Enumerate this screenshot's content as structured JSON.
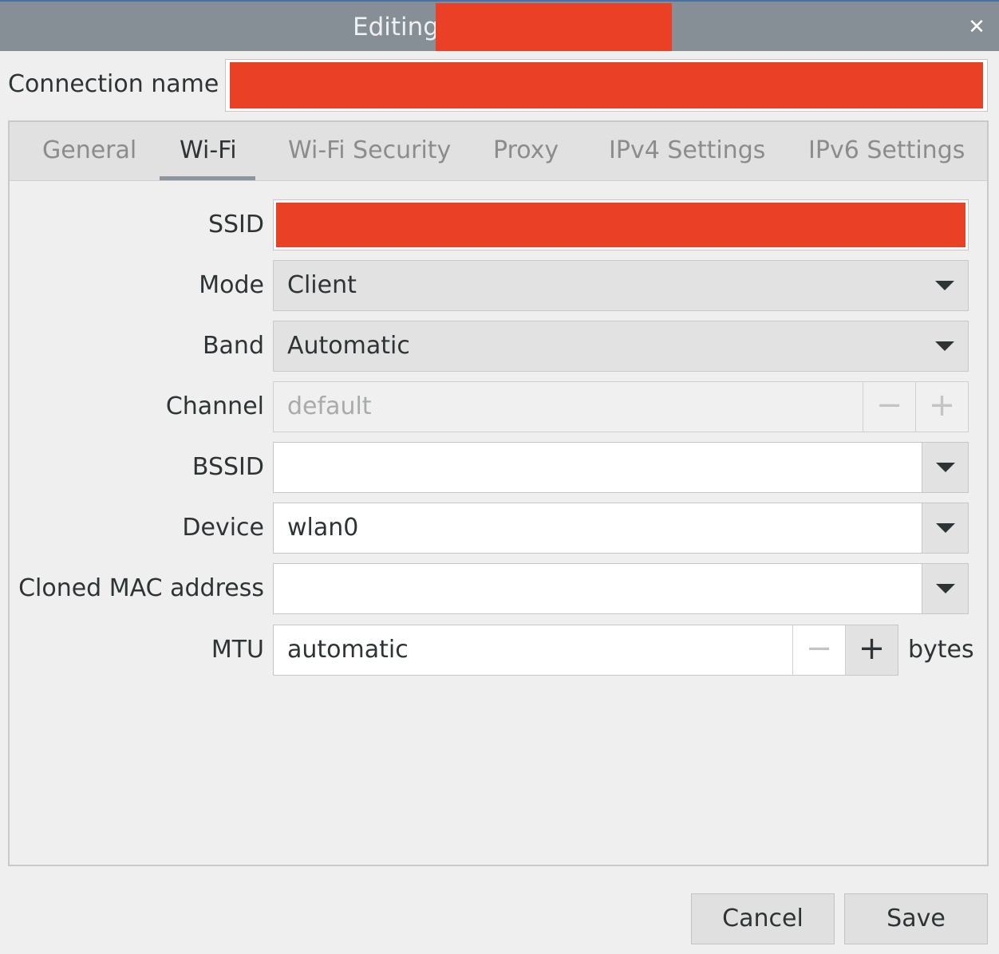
{
  "window": {
    "title": "Editing",
    "close_icon": "close-icon",
    "title_color": "#868e96",
    "redaction_color": "#ea4025"
  },
  "connection": {
    "label": "Connection name",
    "value": ""
  },
  "tabs": [
    {
      "label": "General",
      "active": false
    },
    {
      "label": "Wi-Fi",
      "active": true
    },
    {
      "label": "Wi-Fi Security",
      "active": false
    },
    {
      "label": "Proxy",
      "active": false
    },
    {
      "label": "IPv4 Settings",
      "active": false
    },
    {
      "label": "IPv6 Settings",
      "active": false
    }
  ],
  "wifi": {
    "ssid": {
      "label": "SSID",
      "value": ""
    },
    "mode": {
      "label": "Mode",
      "value": "Client"
    },
    "band": {
      "label": "Band",
      "value": "Automatic"
    },
    "channel": {
      "label": "Channel",
      "value": "default",
      "minus": "−",
      "plus": "+"
    },
    "bssid": {
      "label": "BSSID",
      "value": ""
    },
    "device": {
      "label": "Device",
      "value": "wlan0"
    },
    "cloned_mac": {
      "label": "Cloned MAC address",
      "value": ""
    },
    "mtu": {
      "label": "MTU",
      "value": "automatic",
      "minus": "−",
      "plus": "+",
      "unit": "bytes"
    }
  },
  "buttons": {
    "cancel": "Cancel",
    "save": "Save"
  }
}
